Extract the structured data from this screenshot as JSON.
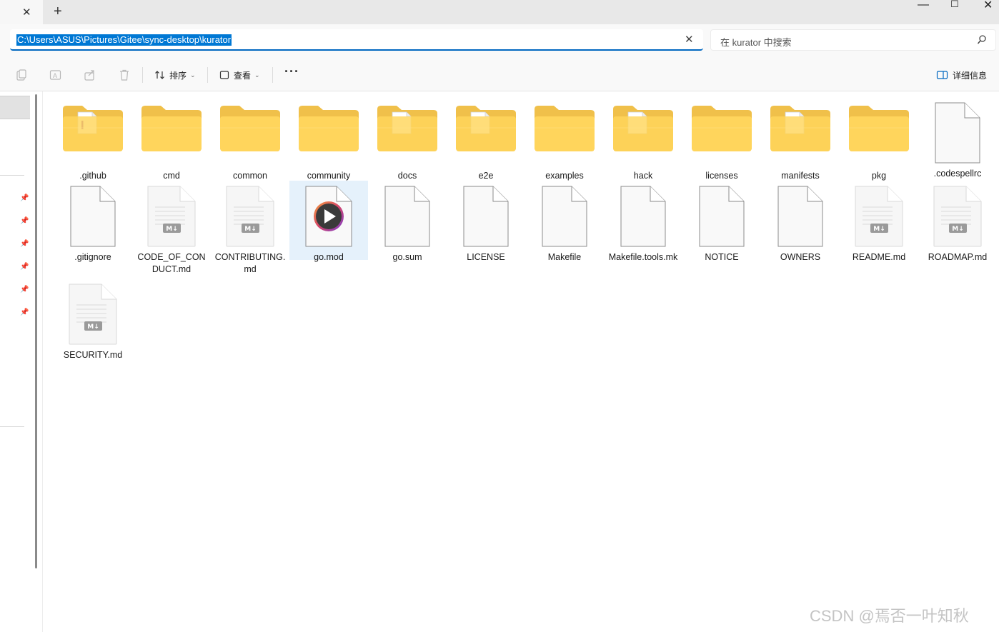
{
  "window": {
    "tab_close": "✕",
    "new_tab": "+",
    "minimize": "—",
    "maximize": "☐",
    "close": "✕"
  },
  "address": {
    "path": "C:\\Users\\ASUS\\Pictures\\Gitee\\sync-desktop\\kurator",
    "clear": "✕"
  },
  "search": {
    "placeholder": "在 kurator 中搜索"
  },
  "toolbar": {
    "sort_label": "排序",
    "view_label": "查看",
    "more_label": "···",
    "details_label": "详细信息"
  },
  "files": [
    {
      "name": ".github",
      "kind": "folder-doc",
      "accent": "#8e44ad"
    },
    {
      "name": "cmd",
      "kind": "folder"
    },
    {
      "name": "common",
      "kind": "folder"
    },
    {
      "name": "community",
      "kind": "folder"
    },
    {
      "name": "docs",
      "kind": "folder-doc"
    },
    {
      "name": "e2e",
      "kind": "folder-doc"
    },
    {
      "name": "examples",
      "kind": "folder"
    },
    {
      "name": "hack",
      "kind": "folder-doc"
    },
    {
      "name": "licenses",
      "kind": "folder"
    },
    {
      "name": "manifests",
      "kind": "folder-doc"
    },
    {
      "name": "pkg",
      "kind": "folder"
    },
    {
      "name": ".codespellrc",
      "kind": "file"
    },
    {
      "name": ".gitignore",
      "kind": "file"
    },
    {
      "name": "CODE_OF_CONDUCT.md",
      "kind": "md"
    },
    {
      "name": "CONTRIBUTING.md",
      "kind": "md"
    },
    {
      "name": "go.mod",
      "kind": "media",
      "selected": true
    },
    {
      "name": "go.sum",
      "kind": "file"
    },
    {
      "name": "LICENSE",
      "kind": "file"
    },
    {
      "name": "Makefile",
      "kind": "file"
    },
    {
      "name": "Makefile.tools.mk",
      "kind": "file"
    },
    {
      "name": "NOTICE",
      "kind": "file"
    },
    {
      "name": "OWNERS",
      "kind": "file"
    },
    {
      "name": "README.md",
      "kind": "md"
    },
    {
      "name": "ROADMAP.md",
      "kind": "md"
    },
    {
      "name": "SECURITY.md",
      "kind": "md"
    }
  ],
  "watermark": "CSDN @焉否一叶知秋",
  "colors": {
    "accent": "#0078d4",
    "folder_back": "#f0c04a",
    "folder_front": "#ffd55c",
    "selection": "#e5f1fb"
  },
  "icons": {
    "copy": "copy-icon",
    "rename": "rename-icon",
    "share": "share-icon",
    "delete": "delete-icon",
    "sort": "sort-icon",
    "view": "view-icon",
    "details": "details-pane-icon",
    "search": "search-icon",
    "pin": "pin-icon"
  }
}
